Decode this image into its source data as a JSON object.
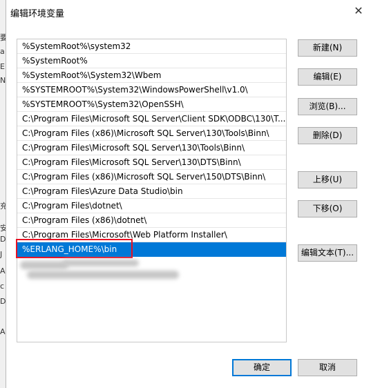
{
  "background_window": {
    "chars": [
      "要",
      "a",
      "E",
      "N",
      "充",
      "安",
      "D",
      "J",
      "A",
      "c",
      "D",
      "A"
    ]
  },
  "dialog": {
    "title": "编辑环境变量",
    "close_glyph": "✕"
  },
  "paths": [
    "%SystemRoot%\\system32",
    "%SystemRoot%",
    "%SystemRoot%\\System32\\Wbem",
    "%SYSTEMROOT%\\System32\\WindowsPowerShell\\v1.0\\",
    "%SYSTEMROOT%\\System32\\OpenSSH\\",
    "C:\\Program Files\\Microsoft SQL Server\\Client SDK\\ODBC\\130\\T...",
    "C:\\Program Files (x86)\\Microsoft SQL Server\\130\\Tools\\Binn\\",
    "C:\\Program Files\\Microsoft SQL Server\\130\\Tools\\Binn\\",
    "C:\\Program Files\\Microsoft SQL Server\\130\\DTS\\Binn\\",
    "C:\\Program Files (x86)\\Microsoft SQL Server\\150\\DTS\\Binn\\",
    "C:\\Program Files\\Azure Data Studio\\bin",
    "C:\\Program Files\\dotnet\\",
    "C:\\Program Files (x86)\\dotnet\\",
    "C:\\Program Files\\Microsoft\\Web Platform Installer\\",
    "%ERLANG_HOME%\\bin"
  ],
  "selected_index": 14,
  "buttons": {
    "new": "新建(N)",
    "edit": "编辑(E)",
    "browse": "浏览(B)...",
    "delete": "删除(D)",
    "move_up": "上移(U)",
    "move_down": "下移(O)",
    "edit_text": "编辑文本(T)...",
    "ok": "确定",
    "cancel": "取消"
  },
  "colors": {
    "selection": "#0078d7",
    "highlight_box": "#e81123"
  }
}
